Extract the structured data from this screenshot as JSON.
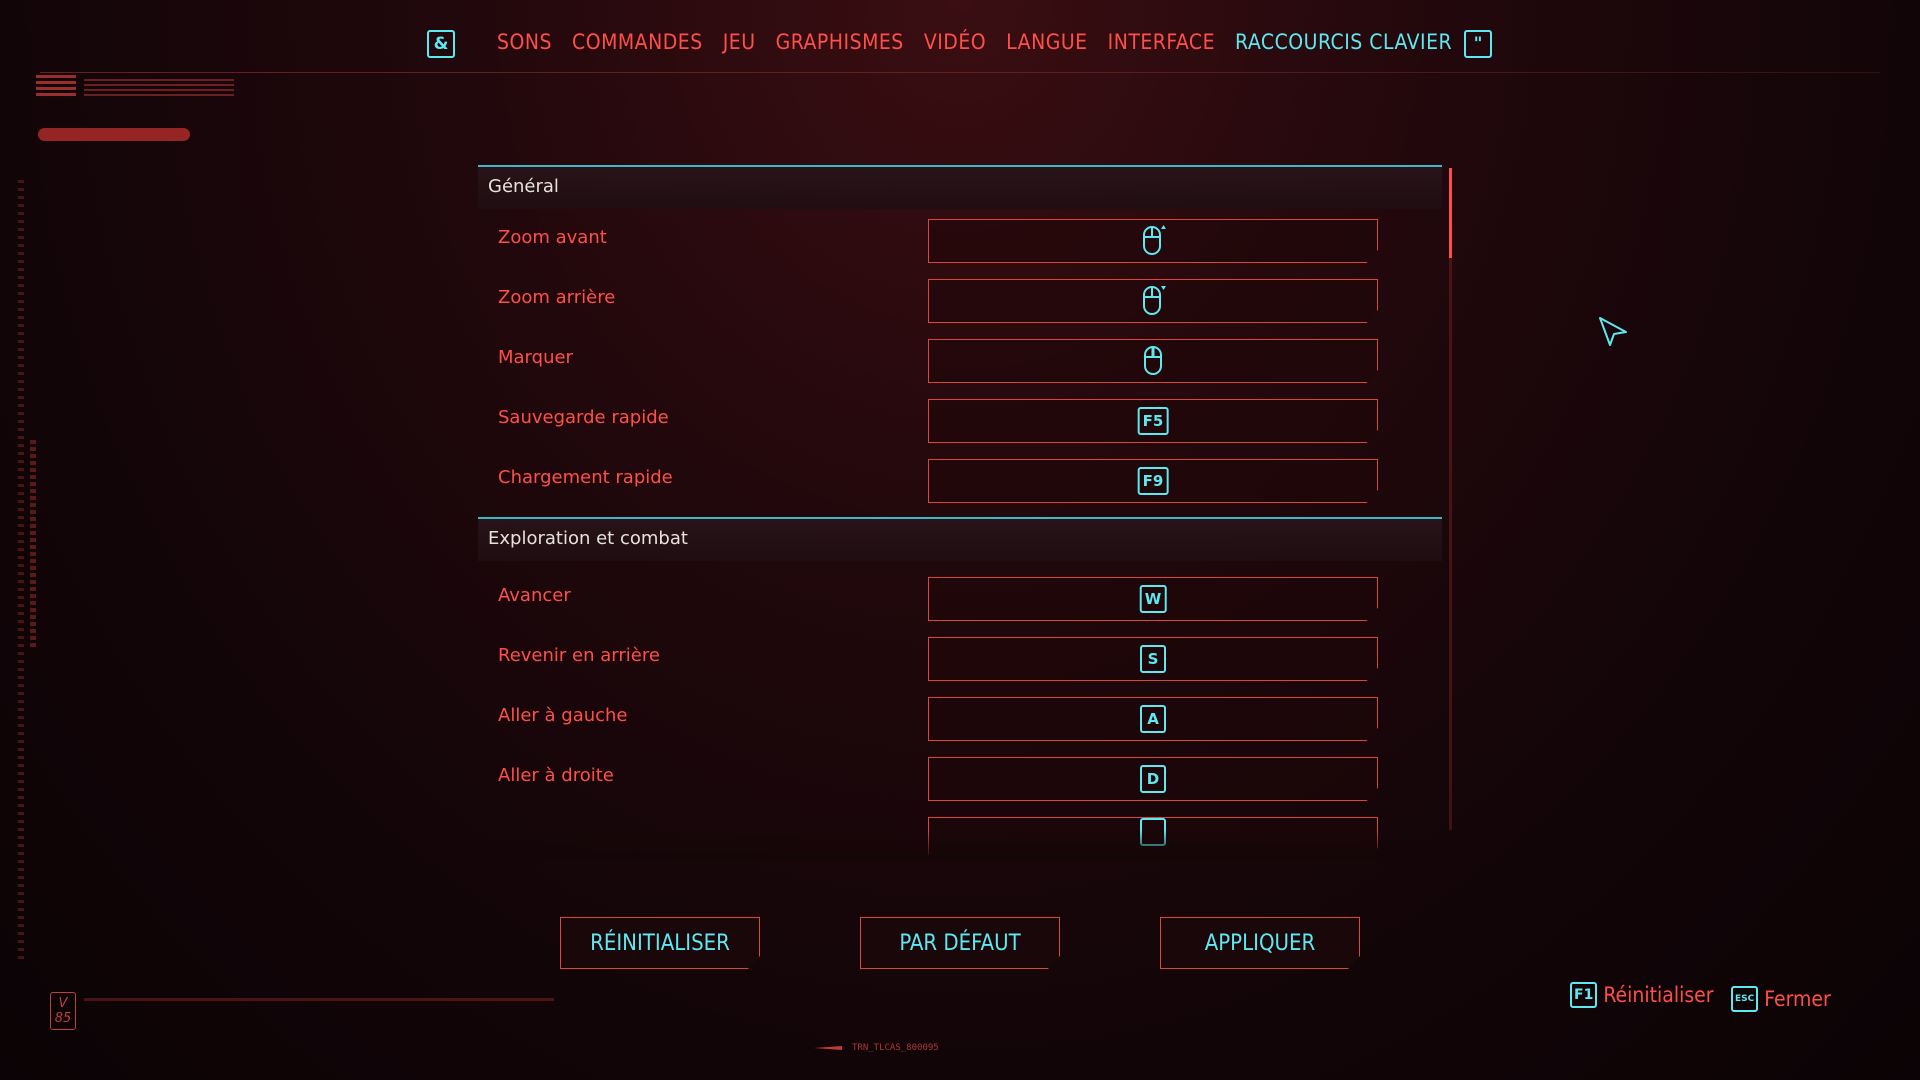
{
  "nav": {
    "left_key": "&",
    "right_key": "\"",
    "tabs": [
      {
        "label": "SONS"
      },
      {
        "label": "COMMANDES"
      },
      {
        "label": "JEU"
      },
      {
        "label": "GRAPHISMES"
      },
      {
        "label": "VIDÉO"
      },
      {
        "label": "LANGUE"
      },
      {
        "label": "INTERFACE"
      },
      {
        "label": "RACCOURCIS CLAVIER"
      }
    ],
    "active_tab": "RACCOURCIS CLAVIER"
  },
  "sections": [
    {
      "title": "Général",
      "rows": [
        {
          "label": "Zoom avant",
          "binding_icon": "mouse-wheel-up-icon"
        },
        {
          "label": "Zoom arrière",
          "binding_icon": "mouse-wheel-down-icon"
        },
        {
          "label": "Marquer",
          "binding_icon": "mouse-middle-button-icon"
        },
        {
          "label": "Sauvegarde rapide",
          "key": "F5"
        },
        {
          "label": "Chargement rapide",
          "key": "F9"
        }
      ]
    },
    {
      "title": "Exploration et combat",
      "rows": [
        {
          "label": "Avancer",
          "key": "W"
        },
        {
          "label": "Revenir en arrière",
          "key": "S"
        },
        {
          "label": "Aller à gauche",
          "key": "A"
        },
        {
          "label": "Aller à droite",
          "key": "D"
        }
      ]
    }
  ],
  "buttons": {
    "reset": "RÉINITIALISER",
    "defaults": "PAR DÉFAUT",
    "apply": "APPLIQUER"
  },
  "hints": {
    "reset_key": "F1",
    "reset_label": "Réinitialiser",
    "close_key": "ESC",
    "close_label": "Fermer"
  },
  "footer": {
    "version_badge": "V\n85",
    "build_code": "TRN_TLCAS_800095"
  },
  "colors": {
    "accent_red": "#ff4f4a",
    "accent_cyan": "#5ee8f0",
    "background": "#1a0609"
  }
}
